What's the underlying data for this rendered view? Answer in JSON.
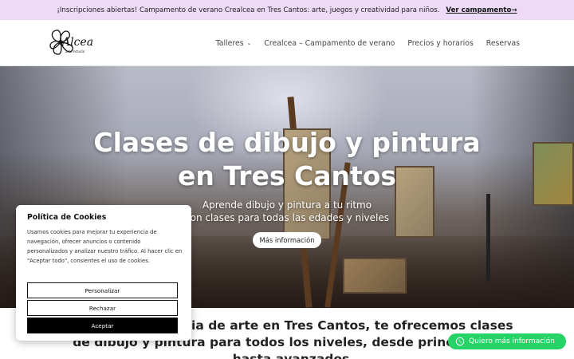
{
  "topbar": {
    "message": "¡Inscripciones abiertas! Campamento de verano Crealcea en Tres Cantos: arte, juegos y creatividad para niños.",
    "cta": "Ver campamento→"
  },
  "header": {
    "logo_text": "Alcea",
    "logo_sub": "arte estudio",
    "nav": [
      {
        "label": "Talleres",
        "has_dropdown": true
      },
      {
        "label": "Crealcea – Campamento de verano",
        "has_dropdown": false
      },
      {
        "label": "Precios y horarios",
        "has_dropdown": false
      },
      {
        "label": "Reservas",
        "has_dropdown": false
      }
    ]
  },
  "hero": {
    "title_line1": "Clases de dibujo y pintura",
    "title_line2": "en Tres Cantos",
    "subtitle_line1": "Aprende dibujo y pintura a tu ritmo",
    "subtitle_line2": "con clases para todas las edades y niveles",
    "button": "Más información"
  },
  "intro": {
    "line1": "En Alcea, academia de arte en Tres Cantos, te ofrecemos clases",
    "line2": "de dibujo y pintura para todos los niveles, desde principiantes",
    "line3": "hasta avanzados"
  },
  "cookie": {
    "title": "Política de Cookies",
    "text": "Usamos cookies para mejorar tu experiencia de navegación, ofrecer anuncios o contenido personalizados y analizar nuestro tráfico. Al hacer clic en \"Aceptar todo\", consientes el uso de cookies.",
    "buttons": {
      "customize": "Personalizar",
      "reject": "Rechazar",
      "accept": "Aceptar"
    }
  },
  "whatsapp": {
    "label": "Quiero más información",
    "icon": "whatsapp-icon"
  },
  "colors": {
    "topbar_bg": "#ecdaf7",
    "whatsapp": "#25d366",
    "accept_bg": "#000000"
  }
}
